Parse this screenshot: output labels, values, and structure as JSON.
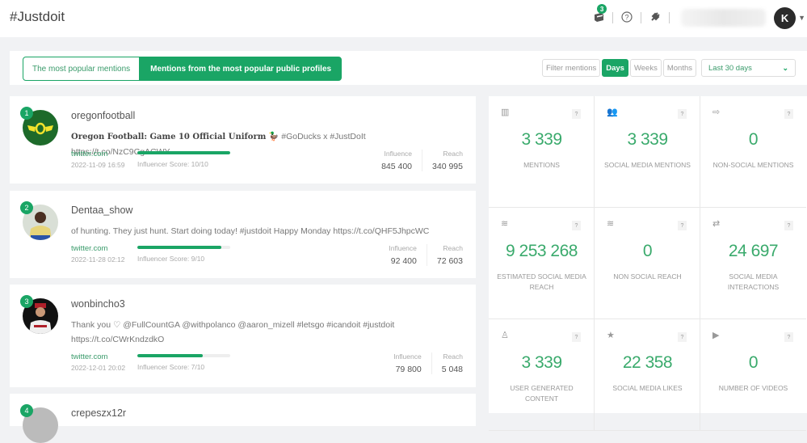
{
  "header": {
    "title": "#Justdoit",
    "notifications_count": "3",
    "help_icon": "question-circle-icon",
    "plugin_icon": "plug-icon",
    "user_initial": "K"
  },
  "toolbar": {
    "tabs": [
      {
        "label": "The most popular mentions",
        "active": false
      },
      {
        "label": "Mentions from the most popular public profiles",
        "active": true
      }
    ],
    "filter_label": "Filter mentions",
    "period_buttons": [
      {
        "label": "Days",
        "active": true
      },
      {
        "label": "Weeks",
        "active": false
      },
      {
        "label": "Months",
        "active": false
      }
    ],
    "range_select": "Last 30 days"
  },
  "mentions": [
    {
      "rank": "1",
      "username": "oregonfootball",
      "text_bold": "Oregon Football: Game 10 Official Uniform",
      "text": " 🦆 #GoDucks x #JustDoIt https://t.co/NzC9CgACWY",
      "source": "twitter.com",
      "date": "2022-11-09 16:59",
      "influencer_score_label": "Influencer Score: 10/10",
      "influencer_score": 10,
      "influence_label": "Influence",
      "influence": "845 400",
      "reach_label": "Reach",
      "reach": "340 995"
    },
    {
      "rank": "2",
      "username": "Dentaa_show",
      "text_bold": "",
      "text": "of hunting. They just hunt. Start doing today! #justdoit Happy Monday https://t.co/QHF5JhpcWC",
      "source": "twitter.com",
      "date": "2022-11-28 02:12",
      "influencer_score_label": "Influencer Score: 9/10",
      "influencer_score": 9,
      "influence_label": "Influence",
      "influence": "92 400",
      "reach_label": "Reach",
      "reach": "72 603"
    },
    {
      "rank": "3",
      "username": "wonbincho3",
      "text_bold": "",
      "text": "Thank you ♡ @FullCountGA @withpolanco @aaron_mizell #letsgo #icandoit #justdoit https://t.co/CWrKndzdkO",
      "source": "twitter.com",
      "date": "2022-12-01 20:02",
      "influencer_score_label": "Influencer Score: 7/10",
      "influencer_score": 7,
      "influence_label": "Influence",
      "influence": "79 800",
      "reach_label": "Reach",
      "reach": "5 048"
    },
    {
      "rank": "4",
      "username": "crepeszx12r"
    }
  ],
  "kpis": [
    {
      "icon": "bar-chart-icon",
      "glyph": "▥",
      "value": "3 339",
      "label": "MENTIONS"
    },
    {
      "icon": "users-icon",
      "glyph": "👥",
      "value": "3 339",
      "label": "SOCIAL MEDIA MENTIONS"
    },
    {
      "icon": "sign-out-icon",
      "glyph": "⇨",
      "value": "0",
      "label": "NON-SOCIAL MENTIONS"
    },
    {
      "icon": "wifi-icon",
      "glyph": "≋",
      "value": "9 253 268",
      "label": "ESTIMATED SOCIAL MEDIA REACH"
    },
    {
      "icon": "wifi-icon",
      "glyph": "≋",
      "value": "0",
      "label": "NON SOCIAL REACH"
    },
    {
      "icon": "exchange-icon",
      "glyph": "⇄",
      "value": "24 697",
      "label": "SOCIAL MEDIA INTERACTIONS"
    },
    {
      "icon": "user-icon",
      "glyph": "♙",
      "value": "3 339",
      "label": "USER GENERATED CONTENT"
    },
    {
      "icon": "star-icon",
      "glyph": "★",
      "value": "22 358",
      "label": "SOCIAL MEDIA LIKES"
    },
    {
      "icon": "play-icon",
      "glyph": "▶",
      "value": "0",
      "label": "NUMBER OF VIDEOS"
    }
  ],
  "help_glyph": "?"
}
